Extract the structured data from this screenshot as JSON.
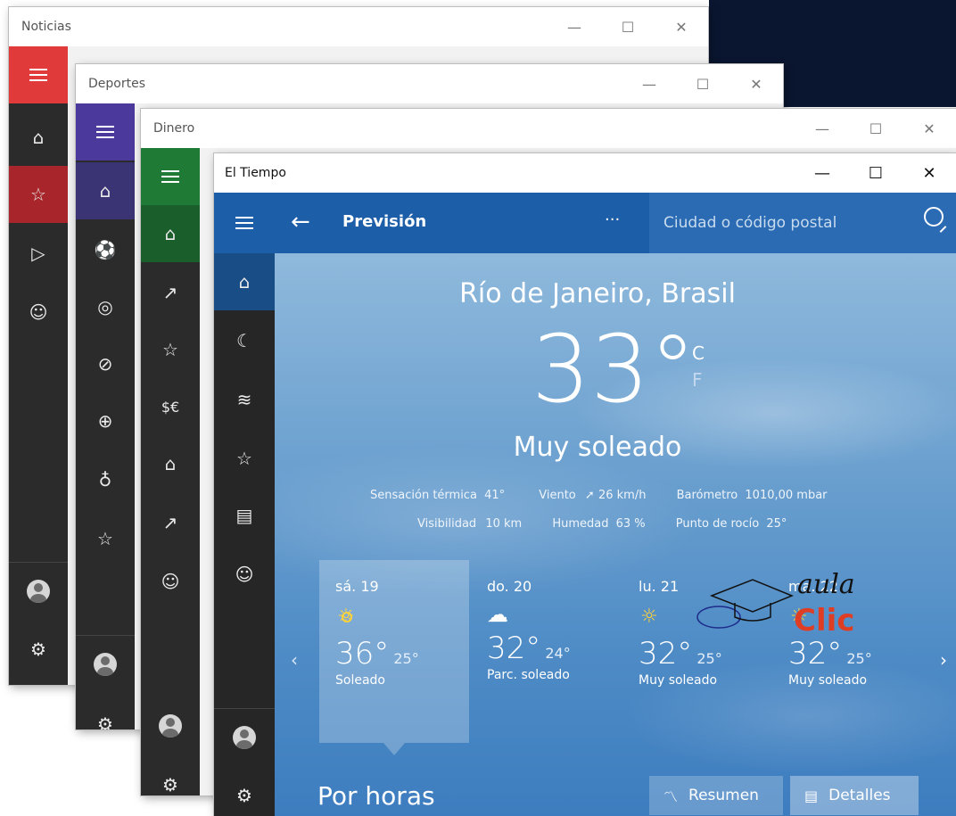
{
  "windows": {
    "noticias": {
      "title": "Noticias",
      "accent": "#e13a3a"
    },
    "deportes": {
      "title": "Deportes",
      "accent": "#4b3a9c"
    },
    "dinero": {
      "title": "Dinero",
      "accent": "#1f7a36"
    },
    "tiempo": {
      "title": "El Tiempo",
      "accent": "#1d5ea8"
    }
  },
  "caption_buttons": {
    "minimize": "—",
    "maximize": "☐",
    "close": "✕"
  },
  "weather": {
    "header": {
      "title": "Previsión",
      "more": "···",
      "search_placeholder": "Ciudad o código postal"
    },
    "location": "Río de Janeiro, Brasil",
    "temperature": "33°",
    "unit_c": "C",
    "unit_f": "F",
    "condition": "Muy soleado",
    "details_row1": {
      "feels_label": "Sensación térmica",
      "feels_value": "41°",
      "wind_label": "Viento",
      "wind_value": "26 km/h",
      "pressure_label": "Barómetro",
      "pressure_value": "1010,00 mbar"
    },
    "details_row2": {
      "visibility_label": "Visibilidad",
      "visibility_value": "10 km",
      "humidity_label": "Humedad",
      "humidity_value": "63 %",
      "dew_label": "Punto de rocío",
      "dew_value": "25°"
    },
    "forecast": [
      {
        "day": "sá. 19",
        "icon": "sun-icon",
        "high": "36°",
        "low": "25°",
        "desc": "Soleado"
      },
      {
        "day": "do. 20",
        "icon": "partly-cloudy-icon",
        "high": "32°",
        "low": "24°",
        "desc": "Parc. soleado"
      },
      {
        "day": "lu. 21",
        "icon": "sun-icon",
        "high": "32°",
        "low": "25°",
        "desc": "Muy soleado"
      },
      {
        "day": "ma. 22",
        "icon": "sun-icon",
        "high": "32°",
        "low": "25°",
        "desc": "Muy soleado"
      }
    ],
    "hourly_title": "Por horas",
    "summary_button": "Resumen",
    "details_button": "Detalles"
  },
  "watermark": {
    "line1": "aula",
    "line2": "Clic"
  }
}
